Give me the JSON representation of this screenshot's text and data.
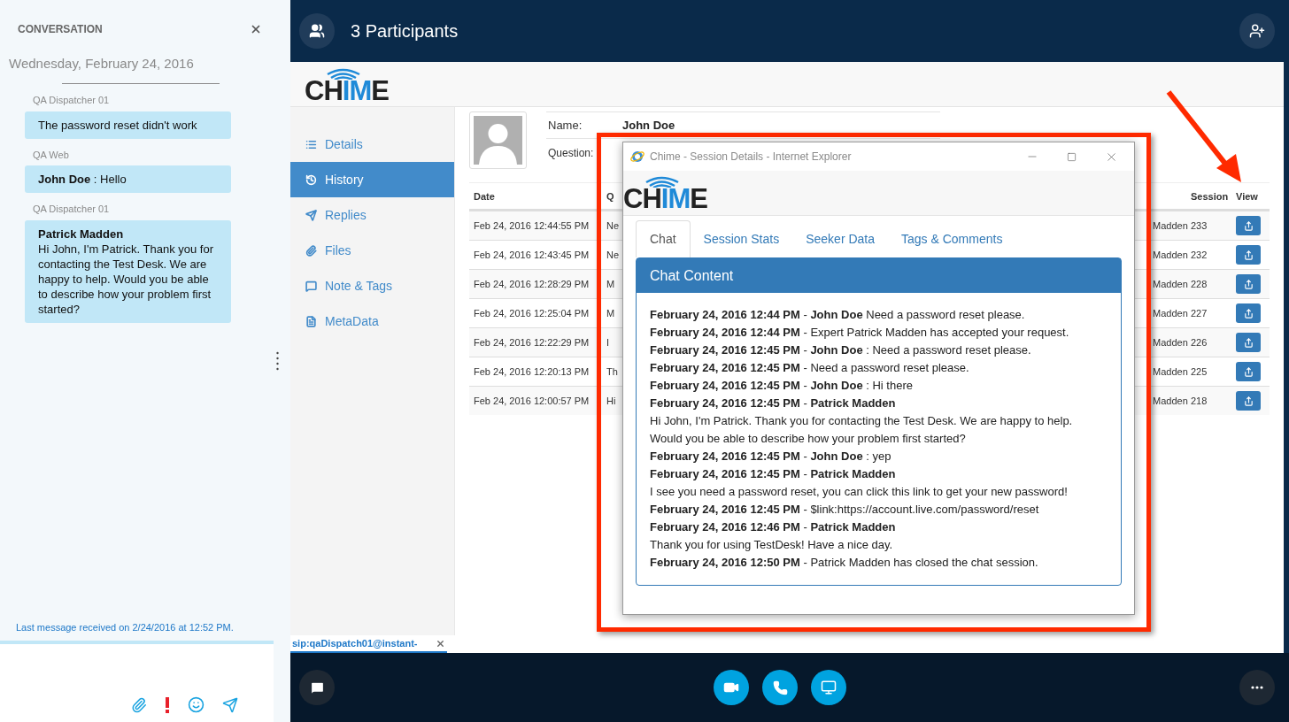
{
  "conversation": {
    "title": "CONVERSATION",
    "date": "Wednesday, February 24, 2016",
    "messages": [
      {
        "sender": "QA Dispatcher 01",
        "text": "The password reset didn't work"
      },
      {
        "sender": "QA Web",
        "text": "**John Doe** : Hello"
      },
      {
        "sender": "QA Dispatcher 01",
        "author": "Patrick Madden",
        "text": "Hi John, I'm Patrick. Thank you for contacting the Test Desk. We are happy to help. Would you be able to describe how your problem first started?"
      }
    ],
    "status": "Last message received on 2/24/2016 at 12:52 PM."
  },
  "call": {
    "title": "3 Participants"
  },
  "web_page": {
    "logo": {
      "lead": "CH",
      "accent": "IM",
      "tail": "E"
    },
    "nav": [
      {
        "label": "Details",
        "selected": false
      },
      {
        "label": "History",
        "selected": true
      },
      {
        "label": "Replies",
        "selected": false
      },
      {
        "label": "Files",
        "selected": false
      },
      {
        "label": "Note & Tags",
        "selected": false
      },
      {
        "label": "MetaData",
        "selected": false
      }
    ],
    "profile": {
      "name_label": "Name:",
      "name": "John Doe",
      "question_label": "Question:"
    },
    "headers": {
      "date": "Date",
      "question": "Q",
      "session": "Session",
      "view": "View"
    },
    "rows": [
      {
        "date": "Feb 24, 2016 12:44:55 PM",
        "question": "Ne",
        "expert": "Madden",
        "session": "233"
      },
      {
        "date": "Feb 24, 2016 12:43:45 PM",
        "question": "Ne",
        "expert": "Madden",
        "session": "232"
      },
      {
        "date": "Feb 24, 2016 12:28:29 PM",
        "question": "M",
        "expert": "Madden",
        "session": "228"
      },
      {
        "date": "Feb 24, 2016 12:25:04 PM",
        "question": "M",
        "expert": "Madden",
        "session": "227"
      },
      {
        "date": "Feb 24, 2016 12:22:29 PM",
        "question": "I",
        "expert": "Madden",
        "session": "226"
      },
      {
        "date": "Feb 24, 2016 12:20:13 PM",
        "question": "Th",
        "expert": "Madden",
        "session": "225"
      },
      {
        "date": "Feb 24, 2016 12:00:57 PM",
        "question": "Hi",
        "expert": "Madden",
        "session": "218"
      }
    ]
  },
  "popup": {
    "title": "Chime - Session Details - Internet Explorer",
    "logo": {
      "lead": "CH",
      "accent": "IM",
      "tail": "E"
    },
    "tabs": [
      {
        "label": "Chat",
        "selected": true
      },
      {
        "label": "Session Stats",
        "selected": false
      },
      {
        "label": "Seeker Data",
        "selected": false
      },
      {
        "label": "Tags & Comments",
        "selected": false
      }
    ],
    "panel_title": "Chat Content",
    "lines": [
      "**February 24, 2016 12:44 PM** - **John Doe** Need a password reset please.",
      "**February 24, 2016 12:44 PM** - Expert Patrick Madden has accepted your request.",
      "**February 24, 2016 12:45 PM** - **John Doe** : Need a password reset please.",
      "**February 24, 2016 12:45 PM** - Need a password reset please.",
      "**February 24, 2016 12:45 PM** - **John Doe** : Hi there",
      "**February 24, 2016 12:45 PM** - **Patrick Madden**",
      "Hi John, I'm Patrick. Thank you for contacting the Test Desk. We are happy to help.",
      "Would you be able to describe how your problem first started?",
      "**February 24, 2016 12:45 PM** - **John Doe** : yep",
      "**February 24, 2016 12:45 PM** - **Patrick Madden**",
      "I see you need a password reset, you can click this link to get your new password!",
      "**February 24, 2016 12:45 PM** - $link:https://account.live.com/password/reset",
      "**February 24, 2016 12:46 PM** - **Patrick Madden**",
      "Thank you for using TestDesk! Have a nice day.",
      "**February 24, 2016 12:50 PM** - Patrick Madden has closed the chat session."
    ]
  },
  "tab_strip": {
    "tab": "sip:qaDispatch01@instant-"
  }
}
